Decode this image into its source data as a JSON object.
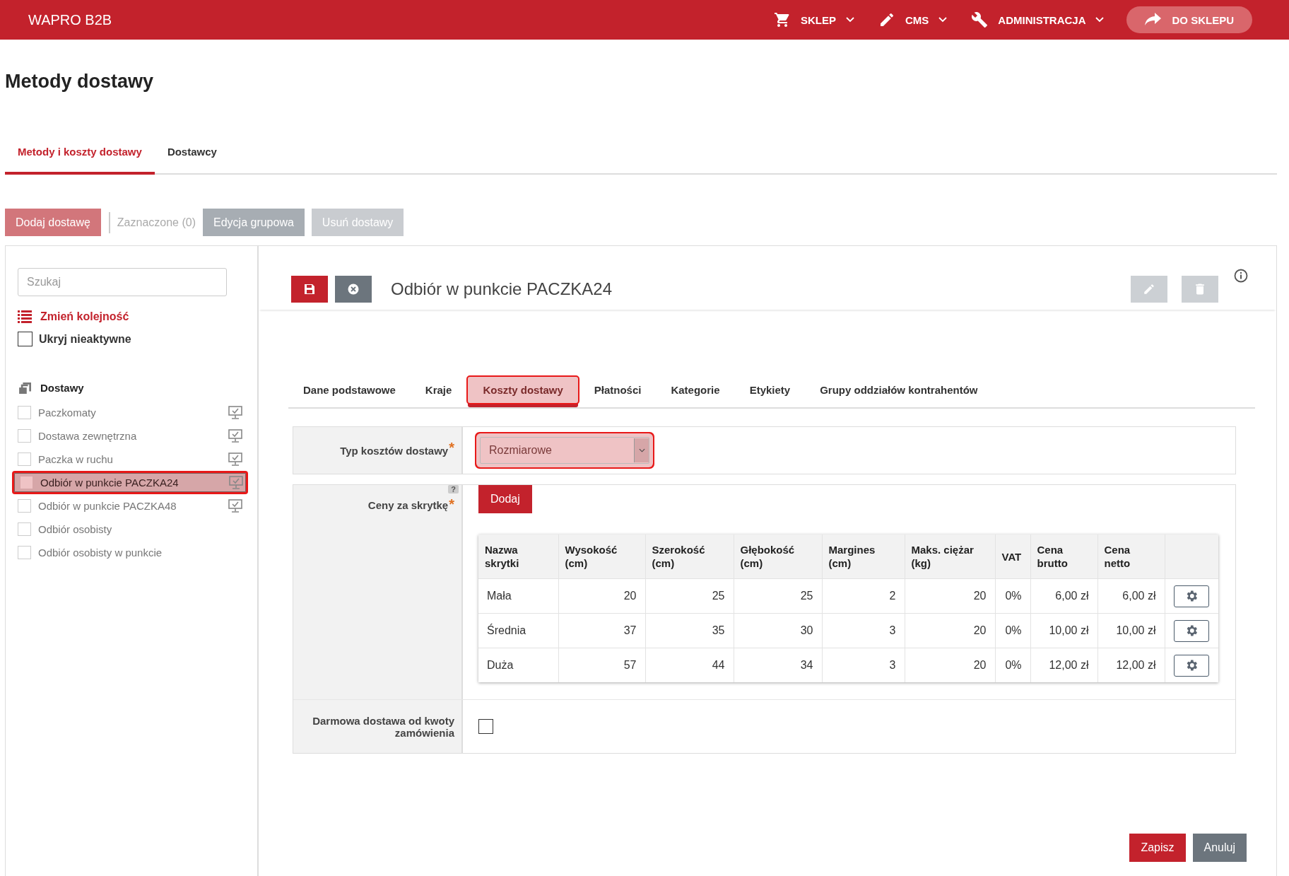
{
  "header": {
    "brand": "WAPRO B2B",
    "menu": [
      {
        "kind": "cart",
        "label": "SKLEP"
      },
      {
        "kind": "pencil",
        "label": "CMS"
      },
      {
        "kind": "wrench",
        "label": "ADMINISTRACJA"
      }
    ],
    "shop_button": "DO SKLEPU"
  },
  "page_title": "Metody dostawy",
  "tabs": [
    {
      "label": "Metody i koszty dostawy",
      "selected": true
    },
    {
      "label": "Dostawcy",
      "selected": false
    }
  ],
  "toolbar": {
    "add": "Dodaj dostawę",
    "selected_count": "Zaznaczone (0)",
    "group_edit": "Edycja grupowa",
    "remove": "Usuń dostawy"
  },
  "sidebar": {
    "search": {
      "placeholder": "Szukaj"
    },
    "reorder": "Zmień kolejność",
    "hide_inactive": {
      "label": "Ukryj nieaktywne",
      "checked": false
    },
    "group": "Dostawy",
    "items": [
      {
        "label": "Paczkomaty",
        "checked": false,
        "selected": false,
        "displayed": true
      },
      {
        "label": "Dostawa zewnętrzna",
        "checked": false,
        "selected": false,
        "displayed": true
      },
      {
        "label": "Paczka w ruchu",
        "checked": false,
        "selected": false,
        "displayed": true
      },
      {
        "label": "Odbiór w punkcie PACZKA24",
        "checked": false,
        "selected": true,
        "displayed": true
      },
      {
        "label": "Odbiór w punkcie PACZKA48",
        "checked": false,
        "selected": false,
        "displayed": true
      },
      {
        "label": "Odbiór osobisty",
        "checked": false,
        "selected": false,
        "displayed": false
      },
      {
        "label": "Odbiór osobisty w punkcie",
        "checked": false,
        "selected": false,
        "displayed": false
      }
    ]
  },
  "detail": {
    "title": "Odbiór w punkcie PACZKA24",
    "tabs": [
      {
        "label": "Dane podstawowe",
        "selected": false
      },
      {
        "label": "Kraje",
        "selected": false
      },
      {
        "label": "Koszty dostawy",
        "selected": true
      },
      {
        "label": "Płatności",
        "selected": false
      },
      {
        "label": "Kategorie",
        "selected": false
      },
      {
        "label": "Etykiety",
        "selected": false
      },
      {
        "label": "Grupy oddziałów kontrahentów",
        "selected": false
      }
    ],
    "cost_type": {
      "label": "Typ kosztów dostawy",
      "required_mark": "*",
      "value": "Rozmiarowe",
      "highlighted": true
    },
    "prices": {
      "label": "Ceny za skrytkę",
      "required_mark": "*",
      "help": "?",
      "add": "Dodaj",
      "columns": [
        "Nazwa skrytki",
        "Wysokość (cm)",
        "Szerokość (cm)",
        "Głębokość (cm)",
        "Margines (cm)",
        "Maks. ciężar (kg)",
        "VAT",
        "Cena brutto",
        "Cena netto"
      ],
      "rows": [
        {
          "cells": [
            "Mała",
            "20",
            "25",
            "25",
            "2",
            "20",
            "0%",
            "6,00 zł",
            "6,00 zł"
          ]
        },
        {
          "cells": [
            "Średnia",
            "37",
            "35",
            "30",
            "3",
            "20",
            "0%",
            "10,00 zł",
            "10,00 zł"
          ]
        },
        {
          "cells": [
            "Duża",
            "57",
            "44",
            "34",
            "3",
            "20",
            "0%",
            "12,00 zł",
            "12,00 zł"
          ]
        }
      ]
    },
    "free_shipping": {
      "label": "Darmowa dostawa od kwoty zamówienia",
      "checked": false
    }
  },
  "footer": {
    "save": "Zapisz",
    "cancel": "Anuluj"
  }
}
